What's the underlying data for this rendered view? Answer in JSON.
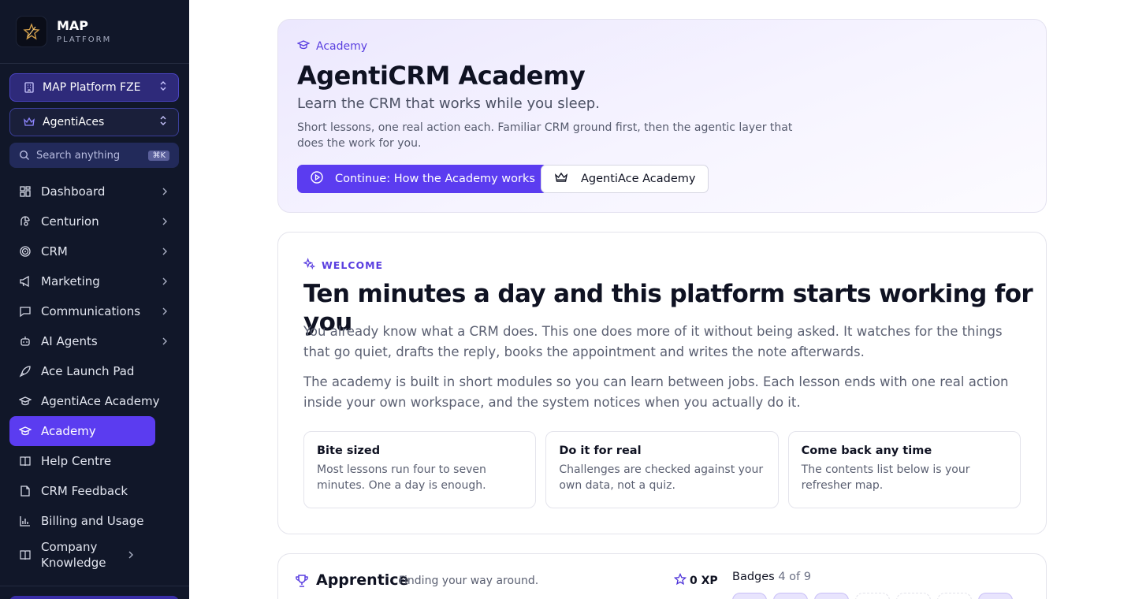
{
  "brand": {
    "title": "MAP",
    "subtitle": "PLATFORM"
  },
  "org_switcher": {
    "label": "MAP Platform FZE"
  },
  "team_switcher": {
    "label": "AgentiAces"
  },
  "search": {
    "placeholder": "Search anything",
    "shortcut": "⌘K"
  },
  "nav": {
    "items": [
      {
        "label": "Dashboard",
        "icon": "dashboard-icon",
        "has_chevron": true
      },
      {
        "label": "Centurion",
        "icon": "centurion-icon",
        "has_chevron": true
      },
      {
        "label": "CRM",
        "icon": "target-icon",
        "has_chevron": true
      },
      {
        "label": "Marketing",
        "icon": "megaphone-icon",
        "has_chevron": true
      },
      {
        "label": "Communications",
        "icon": "chat-icon",
        "has_chevron": true
      },
      {
        "label": "AI Agents",
        "icon": "robot-icon",
        "has_chevron": true
      },
      {
        "label": "Ace Launch Pad",
        "icon": "rocket-icon",
        "has_chevron": false
      },
      {
        "label": "AgentiAce Academy",
        "icon": "graduation-cap-icon",
        "has_chevron": false
      },
      {
        "label": "Academy",
        "icon": "graduation-cap-icon",
        "has_chevron": false,
        "active": true
      },
      {
        "label": "Help Centre",
        "icon": "book-icon",
        "has_chevron": false
      },
      {
        "label": "CRM Feedback",
        "icon": "file-icon",
        "has_chevron": false
      },
      {
        "label": "Billing and Usage",
        "icon": "bar-chart-icon",
        "has_chevron": false
      },
      {
        "label": "Company Knowledge",
        "icon": "book-icon",
        "has_chevron": true
      }
    ]
  },
  "hero": {
    "eyebrow": "Academy",
    "title": "AgentiCRM Academy",
    "tagline": "Learn the CRM that works while you sleep.",
    "description": "Short lessons, one real action each. Familiar CRM ground first, then the agentic layer that does the work for you.",
    "primary_button": "Continue: How the Academy works",
    "secondary_button": "AgentiAce Academy"
  },
  "welcome": {
    "eyebrow": "WELCOME",
    "title": "Ten minutes a day and this platform starts working for you",
    "paragraph_1": "You already know what a CRM does. This one does more of it without being asked. It watches for the things that go quiet, drafts the reply, books the appointment and writes the note afterwards.",
    "paragraph_2": "The academy is built in short modules so you can learn between jobs. Each lesson ends with one real action inside your own workspace, and the system notices when you actually do it.",
    "cards": [
      {
        "title": "Bite sized",
        "body": "Most lessons run four to seven minutes. One a day is enough."
      },
      {
        "title": "Do it for real",
        "body": "Challenges are checked against your own data, not a quiz."
      },
      {
        "title": "Come back any time",
        "body": "The contents list below is your refresher map."
      }
    ]
  },
  "rank": {
    "title": "Apprentice",
    "subtitle": "Finding your way around.",
    "xp": "0 XP",
    "badges_label": "Badges",
    "badges_count": "4 of 9"
  },
  "colors": {
    "accent": "#5b3cf0",
    "sidebar_bg": "#111729"
  }
}
